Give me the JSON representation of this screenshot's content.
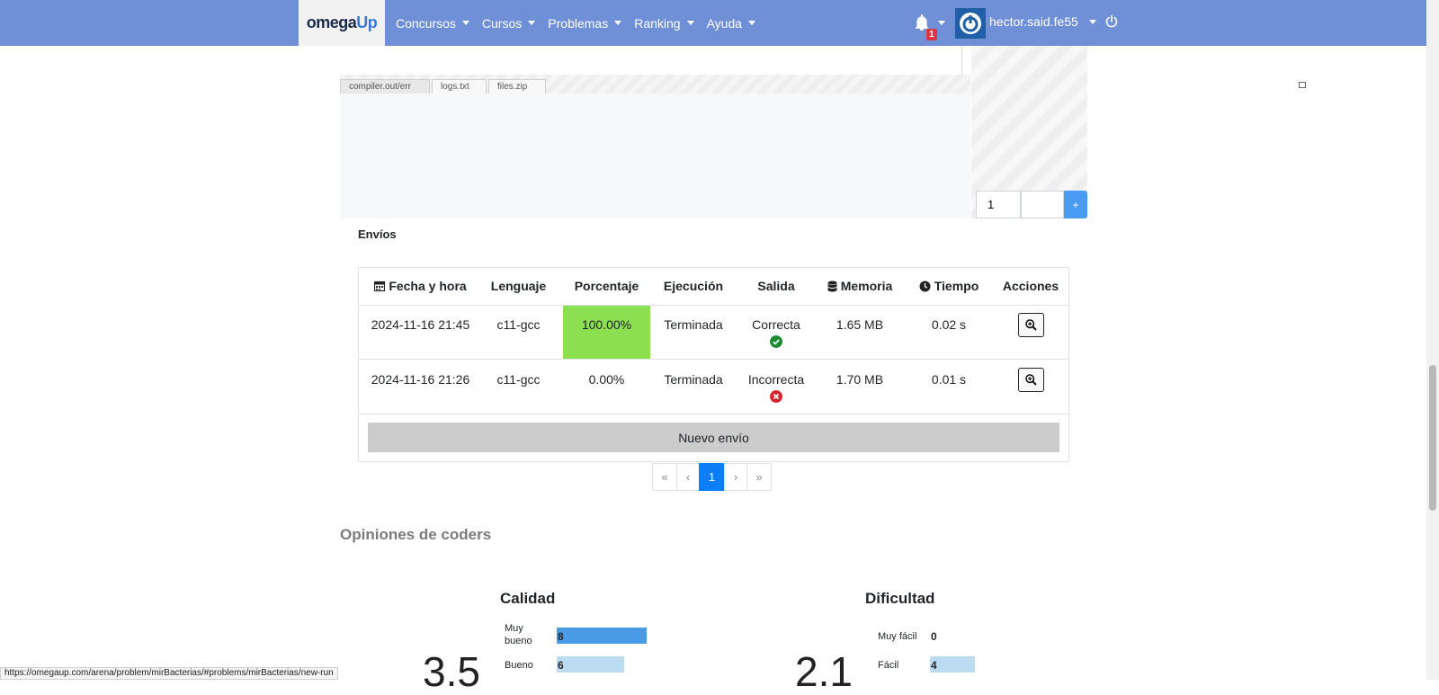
{
  "navbar": {
    "brand_part1": "omega",
    "brand_part2": "Up",
    "menu": [
      "Concursos",
      "Cursos",
      "Problemas",
      "Ranking",
      "Ayuda"
    ],
    "notification_count": "1",
    "username": "hector.said.fe55",
    "color": "#6f90d6"
  },
  "editor": {
    "tabs": [
      "compiler.out/err",
      "logs.txt",
      "files.zip"
    ],
    "case_input_value": "1",
    "add_case_label": "+"
  },
  "runs": {
    "title": "Envíos",
    "headers": [
      "Fecha y hora",
      "Lenguaje",
      "Porcentaje",
      "Ejecución",
      "Salida",
      "Memoria",
      "Tiempo",
      "Acciones"
    ],
    "rows": [
      {
        "date": "2024-11-16 21:45",
        "language": "c11-gcc",
        "percentage": "100.00%",
        "execution": "Terminada",
        "output": "Correcta",
        "memory": "1.65 MB",
        "time": "0.02 s",
        "status": "correct"
      },
      {
        "date": "2024-11-16 21:26",
        "language": "c11-gcc",
        "percentage": "0.00%",
        "execution": "Terminada",
        "output": "Incorrecta",
        "memory": "1.70 MB",
        "time": "0.01 s",
        "status": "wrong"
      }
    ],
    "new_run_label": "Nuevo envío",
    "pager": [
      "«",
      "‹",
      "1",
      "›",
      "»"
    ],
    "success_color": "#8ddf52"
  },
  "opinions": {
    "title": "Opiniones de coders",
    "quality": {
      "title": "Calidad",
      "score": "3.5",
      "items": [
        {
          "label": "Muy bueno",
          "value": 8
        },
        {
          "label": "Bueno",
          "value": 6
        }
      ]
    },
    "difficulty": {
      "title": "Dificultad",
      "score": "2.1",
      "items": [
        {
          "label": "Muy fácil",
          "value": 0
        },
        {
          "label": "Fácil",
          "value": 4
        }
      ]
    }
  },
  "statusbar": {
    "url": "https://omegaup.com/arena/problem/mirBacterias/#problems/mirBacterias/new-run"
  }
}
